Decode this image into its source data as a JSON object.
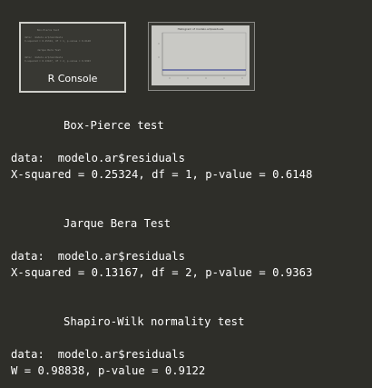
{
  "thumbnails": [
    {
      "label": "R Console",
      "mini_lines": [
        "Box-Pierce test",
        "data:  modelo.ar$residuals",
        "X-squared = 0.25324, df = 1, p-value = 0.6148",
        "Jarque Bera Test",
        "data:  modelo.ar$residuals",
        "X-squared = 0.13167, df = 2, p-value = 0.9363"
      ]
    },
    {
      "mini_title": "Histogram of modelo.ar$residuals"
    }
  ],
  "console": {
    "tests": [
      {
        "title": "Box-Pierce test",
        "data_line": "data:  modelo.ar$residuals",
        "result_line": "X-squared = 0.25324, df = 1, p-value = 0.6148"
      },
      {
        "title": "Jarque Bera Test",
        "data_line": "data:  modelo.ar$residuals",
        "result_line": "X-squared = 0.13167, df = 2, p-value = 0.9363"
      },
      {
        "title": "Shapiro-Wilk normality test",
        "data_line": "data:  modelo.ar$residuals",
        "result_line": "W = 0.98838, p-value = 0.9122"
      }
    ]
  },
  "colors": {
    "background": "#2e2e29",
    "text": "#ffffff",
    "plot_line": "#1f2a8a"
  }
}
